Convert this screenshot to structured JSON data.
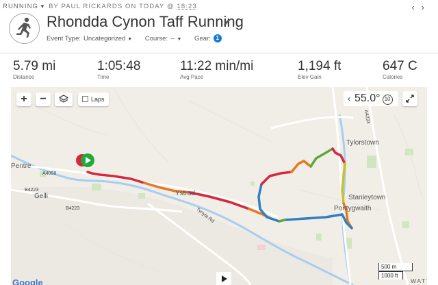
{
  "header": {
    "activity_type": "RUNNING",
    "by_text": "BY PAUL RICKARDS ON TODAY @",
    "time": "18:23",
    "title": "Rhondda Cynon Taff Running",
    "event_type_label": "Event Type:",
    "event_type_value": "Uncategorized",
    "course_label": "Course:",
    "course_value": "--",
    "gear_label": "Gear:",
    "gear_count": "1"
  },
  "stats": [
    {
      "value": "5.79 mi",
      "label": "Distance"
    },
    {
      "value": "1:05:48",
      "label": "Time"
    },
    {
      "value": "11:22 min/mi",
      "label": "Avg Pace"
    },
    {
      "value": "1,194 ft",
      "label": "Elev Gain"
    },
    {
      "value": "647 C",
      "label": "Calories"
    }
  ],
  "map": {
    "zoom_in": "+",
    "zoom_out": "−",
    "laps_label": "Laps",
    "laps_checked": false,
    "temperature": "55.0°",
    "wind_speed": "10",
    "scale_metric": "500 m",
    "scale_imperial": "1000 ft",
    "places": {
      "pentre": "Pentre",
      "gelli": "Gelli",
      "ystrad": "Ystrad",
      "tylorstown": "Tylorstown",
      "stanleytown": "Stanleytown",
      "pontygwaith": "Pontygwaith",
      "wattstown": "WATTST"
    },
    "roads": {
      "a4058": "A4058",
      "b4223_a": "B4223",
      "b4223_b": "B4223",
      "a4233": "A4233",
      "tynyla": "Tynyla Rd"
    },
    "provider": "Google",
    "route_colors": {
      "red": "#d7263d",
      "orange": "#e8771f",
      "yellow": "#c9c12a",
      "green": "#5aa83c",
      "blue": "#2f7fc1",
      "start": "#1faa3a"
    },
    "nav_icons": [
      "chevron-left-icon",
      "chevron-right-icon"
    ]
  }
}
